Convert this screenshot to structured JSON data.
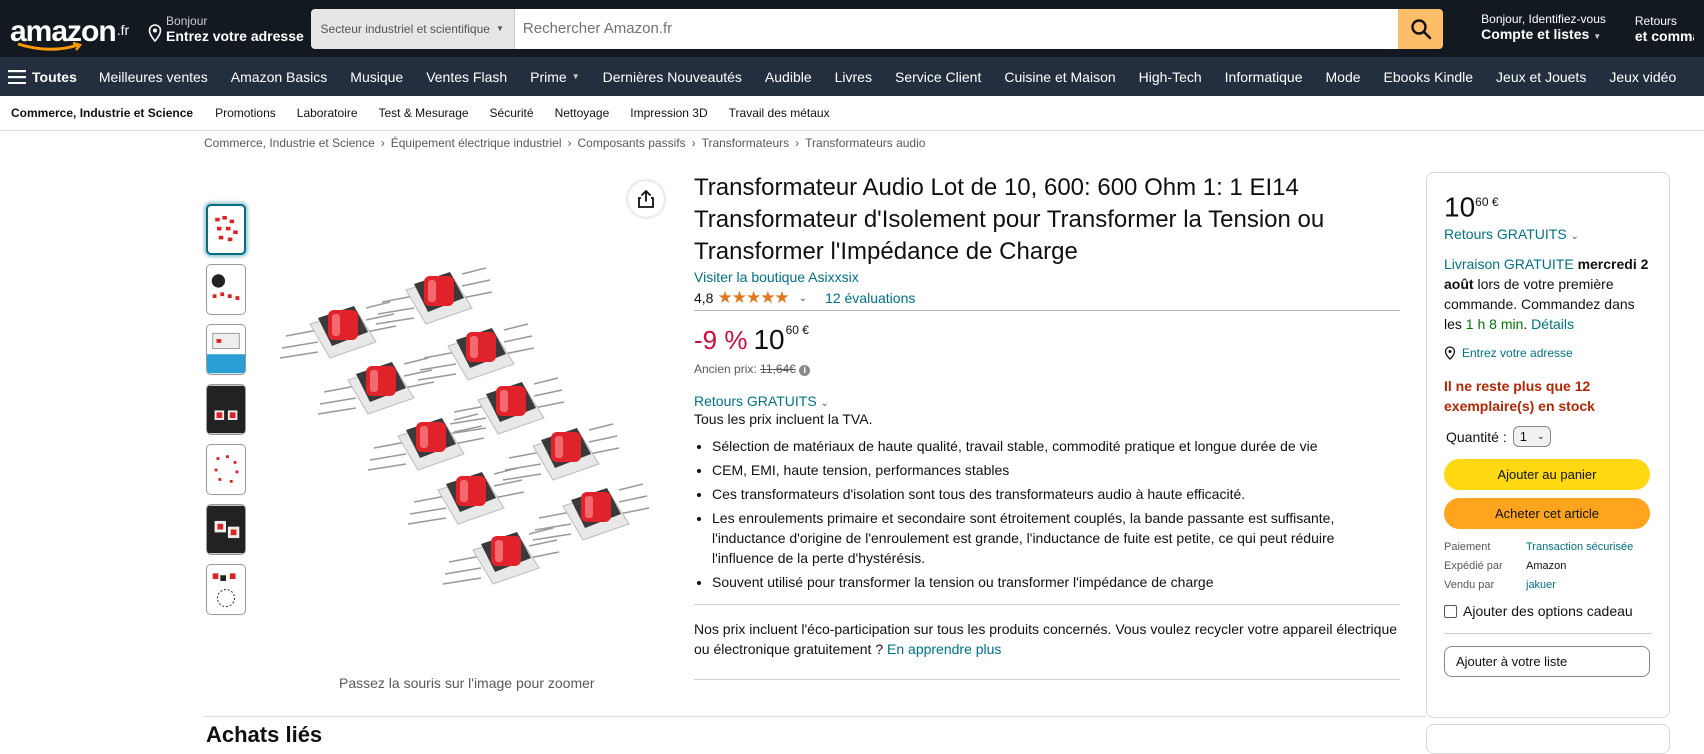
{
  "header": {
    "logo": "amazon",
    "logo_tld": ".fr",
    "deliver_small": "Bonjour",
    "deliver_big": "Entrez votre adresse",
    "search_category": "Secteur industriel et scientifique",
    "search_placeholder": "Rechercher Amazon.fr",
    "account_small": "Bonjour, Identifiez-vous",
    "account_big": "Compte et listes",
    "returns_small": "Retours",
    "returns_big": "et commandes"
  },
  "nav": {
    "all": "Toutes",
    "items": [
      "Meilleures ventes",
      "Amazon Basics",
      "Musique",
      "Ventes Flash",
      "Prime",
      "Dernières Nouveautés",
      "Audible",
      "Livres",
      "Service Client",
      "Cuisine et Maison",
      "High-Tech",
      "Informatique",
      "Mode",
      "Ebooks Kindle",
      "Jeux et Jouets",
      "Jeux vidéo"
    ]
  },
  "subnav": {
    "first": "Commerce, Industrie et Science",
    "items": [
      "Promotions",
      "Laboratoire",
      "Test & Mesurage",
      "Sécurité",
      "Nettoyage",
      "Impression 3D",
      "Travail des métaux"
    ]
  },
  "breadcrumb": [
    "Commerce, Industrie et Science",
    "Équipement électrique industriel",
    "Composants passifs",
    "Transformateurs",
    "Transformateurs audio"
  ],
  "product": {
    "title": "Transformateur Audio Lot de 10, 600: 600 Ohm 1: 1 EI14 Transformateur d'Isolement pour Transformer la Tension ou Transformer l'Impédance de Charge",
    "store": "Visiter la boutique Asixxsix",
    "rating_value": "4,8",
    "stars": "★★★★★",
    "reviews": "12 évaluations",
    "discount": "-9 %",
    "price_whole": "10",
    "price_fraction": "60 €",
    "old_price_label": "Ancien prix:",
    "old_price": "11,64€",
    "returns": "Retours GRATUITS",
    "tva": "Tous les prix incluent la TVA.",
    "bullets": [
      "Sélection de matériaux de haute qualité, travail stable, commodité pratique et longue durée de vie",
      "CEM, EMI, haute tension, performances stables",
      "Ces transformateurs d'isolation sont tous des transformateurs audio à haute efficacité.",
      "Les enroulements primaire et secondaire sont étroitement couplés, la bande passante est suffisante, l'inductance d'origine de l'enroulement est grande, l'inductance de fuite est petite, ce qui peut réduire l'influence de la perte d'hystérésis.",
      "Souvent utilisé pour transformer la tension ou transformer l'impédance de charge"
    ],
    "eco_text": "Nos prix incluent l'éco-participation sur tous les produits concernés. Vous voulez recycler votre appareil électrique ou électronique gratuitement ? ",
    "eco_link": "En apprendre plus",
    "zoom_hint": "Passez la souris sur l'image pour zoomer",
    "section_head": "Achats liés"
  },
  "buybox": {
    "price_whole": "10",
    "price_fraction": "60 €",
    "returns": "Retours GRATUITS",
    "delivery_prefix": "Livraison GRATUITE",
    "delivery_date": "mercredi 2 août",
    "delivery_rest": " lors de votre première commande. Commandez dans les ",
    "delivery_time": "1 h 8 min",
    "delivery_sep": ". ",
    "details": "Détails",
    "address": "Entrez votre adresse",
    "stock": "Il ne reste plus que 12 exemplaire(s) en stock",
    "qty_label": "Quantité :",
    "qty_value": "1",
    "add_cart": "Ajouter au panier",
    "buy_now": "Acheter cet article",
    "payment_label": "Paiement",
    "payment_value": "Transaction sécurisée",
    "shipped_label": "Expédié par",
    "shipped_value": "Amazon",
    "sold_label": "Vendu par",
    "sold_value": "jakuer",
    "gift": "Ajouter des options cadeau",
    "add_list": "Ajouter à votre liste"
  }
}
